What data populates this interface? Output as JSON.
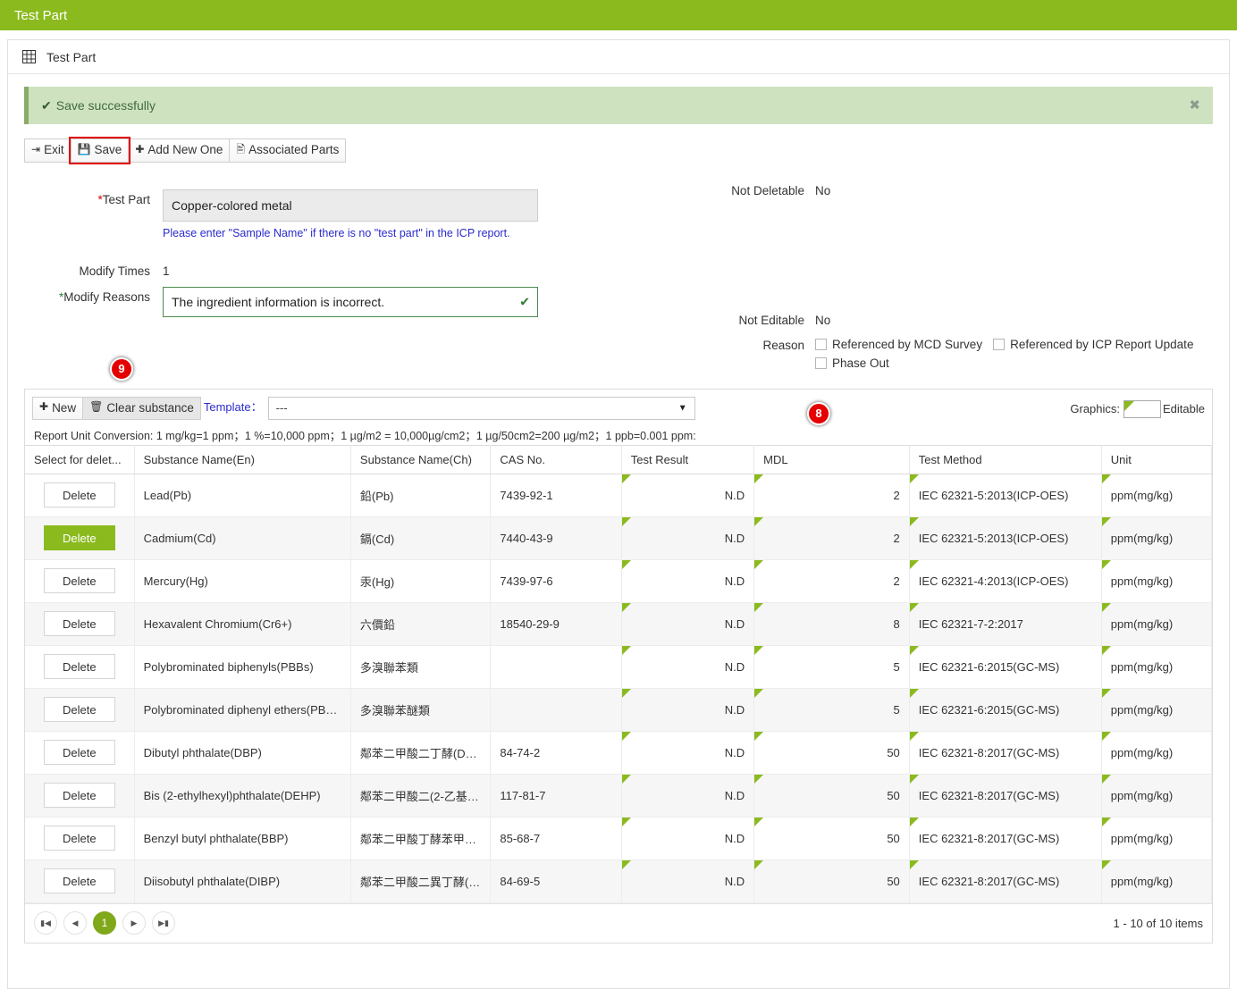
{
  "window": {
    "title": "Test Part"
  },
  "panel": {
    "title": "Test Part",
    "icon": "grid-icon"
  },
  "alert": {
    "text": "Save successfully",
    "check_icon": "check-icon",
    "close_icon": "close-icon",
    "bg": "#cfe2c0",
    "border": "#8aab6a"
  },
  "toolbar": {
    "exit_label": "Exit",
    "save_label": "Save",
    "add_new_one_label": "Add New One",
    "associated_parts_label": "Associated Parts",
    "save_highlight_color": "#e20000"
  },
  "badges": {
    "nine": "9",
    "eight": "8",
    "color": "#e40000"
  },
  "form": {
    "test_part_label": "*Test Part",
    "test_part_value": "Copper-colored metal",
    "test_part_hint": "Please enter \"Sample Name\" if there is no \"test part\" in the ICP report.",
    "modify_times_label": "Modify Times",
    "modify_times_value": "1",
    "modify_reasons_label": "*Modify Reasons",
    "modify_reasons_value": "The ingredient information is incorrect.",
    "not_deletable_label": "Not Deletable",
    "not_deletable_value": "No",
    "not_editable_label": "Not Editable",
    "not_editable_value": "No",
    "reason_label": "Reason",
    "reason_options": [
      {
        "label": "Referenced by MCD Survey",
        "checked": false
      },
      {
        "label": "Referenced by ICP Report Update",
        "checked": false
      },
      {
        "label": "Phase Out",
        "checked": false
      }
    ]
  },
  "grid_toolbar": {
    "new_label": "New",
    "clear_substance_label": "Clear substance",
    "template_label": "Template：",
    "template_value": "---",
    "conversion_note": "Report Unit Conversion: 1 mg/kg=1 ppm；1 %=10,000 ppm；1 µg/m2 = 10,000µg/cm2；1 µg/50cm2=200 µg/m2；1 ppb=0.001 ppm:",
    "graphics_label": "Graphics:",
    "editable_label": "Editable"
  },
  "table": {
    "columns": [
      "Select for delet...",
      "Substance Name(En)",
      "Substance Name(Ch)",
      "CAS No.",
      "Test Result",
      "MDL",
      "Test Method",
      "Unit"
    ],
    "delete_label": "Delete",
    "rows": [
      {
        "name_en": "Lead(Pb)",
        "name_ch": "鉛(Pb)",
        "cas": "7439-92-1",
        "result": "N.D",
        "mdl": "2",
        "method": "IEC 62321-5:2013(ICP-OES)",
        "unit": "ppm(mg/kg)",
        "selected": false
      },
      {
        "name_en": "Cadmium(Cd)",
        "name_ch": "鎘(Cd)",
        "cas": "7440-43-9",
        "result": "N.D",
        "mdl": "2",
        "method": "IEC 62321-5:2013(ICP-OES)",
        "unit": "ppm(mg/kg)",
        "selected": true
      },
      {
        "name_en": "Mercury(Hg)",
        "name_ch": "汞(Hg)",
        "cas": "7439-97-6",
        "result": "N.D",
        "mdl": "2",
        "method": "IEC 62321-4:2013(ICP-OES)",
        "unit": "ppm(mg/kg)",
        "selected": false
      },
      {
        "name_en": "Hexavalent Chromium(Cr6+)",
        "name_ch": "六價鉛",
        "cas": "18540-29-9",
        "result": "N.D",
        "mdl": "8",
        "method": "IEC 62321-7-2:2017",
        "unit": "ppm(mg/kg)",
        "selected": false
      },
      {
        "name_en": "Polybrominated biphenyls(PBBs)",
        "name_ch": "多溴聯苯類",
        "cas": "",
        "result": "N.D",
        "mdl": "5",
        "method": "IEC 62321-6:2015(GC-MS)",
        "unit": "ppm(mg/kg)",
        "selected": false
      },
      {
        "name_en": "Polybrominated diphenyl ethers(PB…",
        "name_ch": "多溴聯苯醚類",
        "cas": "",
        "result": "N.D",
        "mdl": "5",
        "method": "IEC 62321-6:2015(GC-MS)",
        "unit": "ppm(mg/kg)",
        "selected": false
      },
      {
        "name_en": "Dibutyl phthalate(DBP)",
        "name_ch": "鄰苯二甲酸二丁酵(D…",
        "cas": "84-74-2",
        "result": "N.D",
        "mdl": "50",
        "method": "IEC 62321-8:2017(GC-MS)",
        "unit": "ppm(mg/kg)",
        "selected": false
      },
      {
        "name_en": "Bis (2-ethylhexyl)phthalate(DEHP)",
        "name_ch": "鄰苯二甲酸二(2-乙基…",
        "cas": "117-81-7",
        "result": "N.D",
        "mdl": "50",
        "method": "IEC 62321-8:2017(GC-MS)",
        "unit": "ppm(mg/kg)",
        "selected": false
      },
      {
        "name_en": "Benzyl butyl phthalate(BBP)",
        "name_ch": "鄰苯二甲酸丁酵苯甲…",
        "cas": "85-68-7",
        "result": "N.D",
        "mdl": "50",
        "method": "IEC 62321-8:2017(GC-MS)",
        "unit": "ppm(mg/kg)",
        "selected": false
      },
      {
        "name_en": "Diisobutyl phthalate(DIBP)",
        "name_ch": "鄰苯二甲酸二異丁酵(…",
        "cas": "84-69-5",
        "result": "N.D",
        "mdl": "50",
        "method": "IEC 62321-8:2017(GC-MS)",
        "unit": "ppm(mg/kg)",
        "selected": false
      }
    ]
  },
  "pager": {
    "first_icon": "first-page-icon",
    "prev_icon": "prev-page-icon",
    "current_page": "1",
    "next_icon": "next-page-icon",
    "last_icon": "last-page-icon",
    "count_text": "1 - 10 of 10 items"
  }
}
